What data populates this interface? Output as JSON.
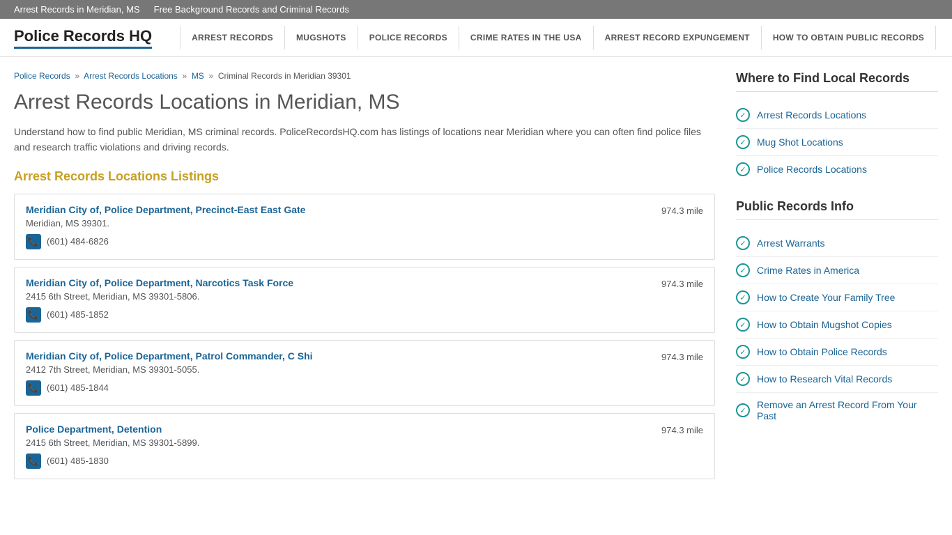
{
  "topbar": {
    "link1": "Arrest Records in Meridian, MS",
    "link2": "Free Background Records and Criminal Records"
  },
  "header": {
    "logo": "Police Records HQ",
    "nav": [
      {
        "label": "ARREST RECORDS"
      },
      {
        "label": "MUGSHOTS"
      },
      {
        "label": "POLICE RECORDS"
      },
      {
        "label": "CRIME RATES IN THE USA"
      },
      {
        "label": "ARREST RECORD EXPUNGEMENT"
      },
      {
        "label": "HOW TO OBTAIN PUBLIC RECORDS"
      }
    ]
  },
  "breadcrumb": {
    "items": [
      {
        "label": "Police Records",
        "href": "#"
      },
      {
        "label": "Arrest Records Locations",
        "href": "#"
      },
      {
        "label": "MS",
        "href": "#"
      },
      {
        "label": "Criminal Records in Meridian 39301"
      }
    ]
  },
  "main": {
    "title": "Arrest Records Locations in Meridian, MS",
    "description": "Understand how to find public Meridian, MS criminal records. PoliceRecordsHQ.com has listings of locations near Meridian where you can often find police files and research traffic violations and driving records.",
    "listings_heading": "Arrest Records Locations Listings",
    "locations": [
      {
        "name": "Meridian City of, Police Department, Precinct-East East Gate",
        "address": "Meridian, MS 39301.",
        "phone": "(601) 484-6826",
        "distance": "974.3 mile"
      },
      {
        "name": "Meridian City of, Police Department, Narcotics Task Force",
        "address": "2415 6th Street, Meridian, MS 39301-5806.",
        "phone": "(601) 485-1852",
        "distance": "974.3 mile"
      },
      {
        "name": "Meridian City of, Police Department, Patrol Commander, C Shi",
        "address": "2412 7th Street, Meridian, MS 39301-5055.",
        "phone": "(601) 485-1844",
        "distance": "974.3 mile"
      },
      {
        "name": "Police Department, Detention",
        "address": "2415 6th Street, Meridian, MS 39301-5899.",
        "phone": "(601) 485-1830",
        "distance": "974.3 mile"
      }
    ]
  },
  "sidebar": {
    "section1": {
      "title": "Where to Find Local Records",
      "links": [
        "Arrest Records Locations",
        "Mug Shot Locations",
        "Police Records Locations"
      ]
    },
    "section2": {
      "title": "Public Records Info",
      "links": [
        "Arrest Warrants",
        "Crime Rates in America",
        "How to Create Your Family Tree",
        "How to Obtain Mugshot Copies",
        "How to Obtain Police Records",
        "How to Research Vital Records",
        "Remove an Arrest Record From Your Past"
      ]
    }
  }
}
